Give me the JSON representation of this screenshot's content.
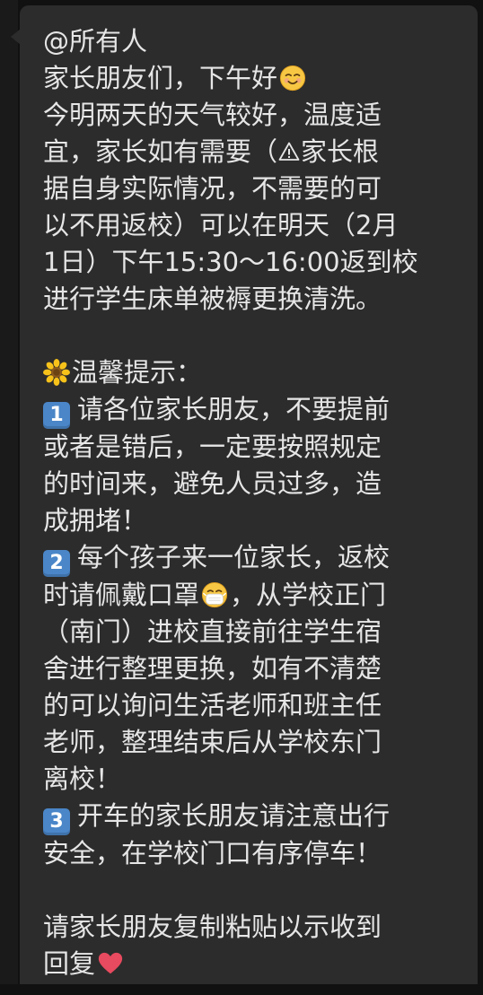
{
  "message": {
    "mention": "@所有人",
    "greeting": "家长朋友们，下午好",
    "para1_line1": "今明两天的天气较好，温度适",
    "para1_line2a": "宜，家长如有需要（",
    "para1_line2b": "家长根",
    "para1_line3": "据自身实际情况，不需要的可",
    "para1_line4": "以不用返校）可以在明天（2月",
    "para1_line5": "1日）下午15:30～16:00返到校",
    "para1_line6": "进行学生床单被褥更换清洗。",
    "tips_title": "温馨提示：",
    "tip1_num": "1",
    "tip1_line1": "请各位家长朋友，不要提前",
    "tip1_line2": "或者是错后，一定要按照规定",
    "tip1_line3": "的时间来，避免人员过多，造",
    "tip1_line4": "成拥堵！",
    "tip2_num": "2",
    "tip2_line1": "每个孩子来一位家长，返校",
    "tip2_line2a": "时请佩戴口罩",
    "tip2_line2b": "，从学校正门",
    "tip2_line3": "（南门）进校直接前往学生宿",
    "tip2_line4": "舍进行整理更换，如有不清楚",
    "tip2_line5": "的可以询问生活老师和班主任",
    "tip2_line6": "老师，整理结束后从学校东门",
    "tip2_line7": "离校！",
    "tip3_num": "3",
    "tip3_line1": "开车的家长朋友请注意出行",
    "tip3_line2": "安全，在学校门口有序停车！",
    "closing_line1": "请家长朋友复制粘贴以示收到",
    "closing_line2": "回复"
  },
  "icons": {
    "smile": "relieved-smile-emoji-icon",
    "warning": "warning-icon",
    "flower": "sunflower-emoji-icon",
    "mask": "face-with-mask-emoji-icon",
    "heart": "red-heart-emoji-icon"
  },
  "colors": {
    "bubble": "#2c2c2c",
    "background": "#111111",
    "text": "#e6e6e6",
    "badge": "#4a86c8",
    "heart": "#e84a5f"
  }
}
